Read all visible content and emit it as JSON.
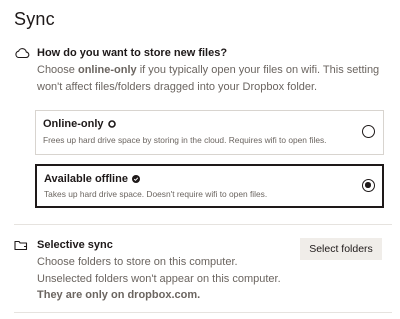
{
  "page": {
    "title": "Sync"
  },
  "storage": {
    "icon": "cloud-icon",
    "title": "How do you want to store new files?",
    "desc_1": "Choose ",
    "desc_bold": "online-only",
    "desc_2": " if you typically open your files on wifi. This setting won't affect files/folders dragged into your Dropbox folder.",
    "options": [
      {
        "title": "Online-only",
        "badge_icon": "cloud-outline-icon",
        "desc": "Frees up hard drive space by storing in the cloud. Requires wifi to open files.",
        "selected": false
      },
      {
        "title": "Available offline",
        "badge_icon": "check-circle-icon",
        "desc": "Takes up hard drive space. Doesn't require wifi to open files.",
        "selected": true
      }
    ]
  },
  "selective_sync": {
    "icon": "folder-icon",
    "title": "Selective sync",
    "desc_1": "Choose folders to store on this computer. Unselected folders won't appear on this computer. ",
    "desc_bold": "They are only on dropbox.com.",
    "button_label": "Select folders"
  }
}
